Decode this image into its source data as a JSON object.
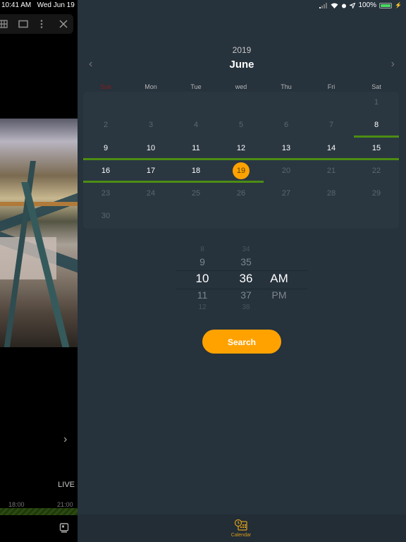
{
  "status_bar": {
    "time": "10:41 AM",
    "date": "Wed Jun 19",
    "battery": "100%",
    "icons": [
      "signal-icon",
      "wifi-icon",
      "alarm-icon",
      "location-icon",
      "battery-icon",
      "charging-icon"
    ]
  },
  "left_toolbar": {
    "icons": [
      "grid-icon",
      "single-view-icon",
      "more-vertical-icon",
      "close-icon"
    ]
  },
  "player": {
    "live_label": "LIVE",
    "timeline_labels": [
      "18:00",
      "21:00"
    ],
    "next_icon": "chevron-right-icon",
    "bottom_icon": "playback-icon"
  },
  "calendar": {
    "year": "2019",
    "month": "June",
    "prev_icon": "chevron-left-icon",
    "next_icon": "chevron-right-icon",
    "weekdays": [
      "Sun",
      "Mon",
      "Tue",
      "wed",
      "Thu",
      "Fri",
      "Sat"
    ],
    "weekend_color": "#8b1a1a",
    "accent_color": "#ffa200",
    "recording_color": "#4c8d12",
    "weeks": [
      [
        "",
        "",
        "",
        "",
        "",
        "",
        "1"
      ],
      [
        "2",
        "3",
        "4",
        "5",
        "6",
        "7",
        "8"
      ],
      [
        "9",
        "10",
        "11",
        "12",
        "13",
        "14",
        "15"
      ],
      [
        "16",
        "17",
        "18",
        "19",
        "20",
        "21",
        "22"
      ],
      [
        "23",
        "24",
        "25",
        "26",
        "27",
        "28",
        "29"
      ],
      [
        "30",
        "",
        "",
        "",
        "",
        "",
        ""
      ]
    ],
    "recorded_days": [
      "8",
      "9",
      "10",
      "11",
      "12",
      "13",
      "14",
      "15",
      "16",
      "17",
      "18",
      "19"
    ],
    "selected_day": "19"
  },
  "time_picker": {
    "hours": [
      "8",
      "9",
      "10",
      "11",
      "12"
    ],
    "minutes": [
      "34",
      "35",
      "36",
      "37",
      "38"
    ],
    "periods": [
      "AM",
      "PM"
    ],
    "selected": {
      "hour": "10",
      "minute": "36",
      "period": "AM"
    }
  },
  "search_button": "Search",
  "tab_bar": {
    "tabs": [
      {
        "label": "Calendar",
        "icon": "calendar-clock-icon",
        "active": true
      }
    ]
  }
}
